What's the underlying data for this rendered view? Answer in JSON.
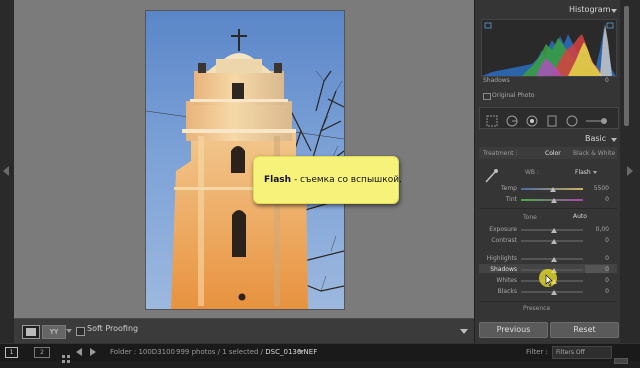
{
  "histogram": {
    "title": "Histogram",
    "left_readout": "Shadows",
    "right_readout": "0",
    "original_photo_label": "Original Photo"
  },
  "basic": {
    "title": "Basic",
    "treatment_label": "Treatment :",
    "treatment_options": [
      "Color",
      "Black & White"
    ],
    "treatment_selected": "Color",
    "wb_label": "WB :",
    "wb_value": "Flash",
    "temp_label": "Temp",
    "temp_value": "5500",
    "tint_label": "Tint",
    "tint_value": "0",
    "tone_label": "Tone",
    "auto_label": "Auto",
    "exposure_label": "Exposure",
    "exposure_value": "0,00",
    "contrast_label": "Contrast",
    "contrast_value": "0",
    "highlights_label": "Highlights",
    "highlights_value": "0",
    "shadows_label": "Shadows",
    "shadows_value": "0",
    "whites_label": "Whites",
    "whites_value": "0",
    "blacks_label": "Blacks",
    "blacks_value": "0",
    "presence_label": "Presence"
  },
  "buttons": {
    "previous": "Previous",
    "reset": "Reset"
  },
  "toolbar": {
    "view_mode_label": "YY",
    "soft_proofing_label": "Soft Proofing"
  },
  "status": {
    "screen1": "1",
    "screen2": "2",
    "folder": "Folder : 100D3100",
    "photos": "999 photos / 1 selected / ",
    "filename": "DSC_0136.NEF",
    "filename_suffix": "",
    "filter_label": "Filter :",
    "filter_value": "Filters Off"
  },
  "tooltip": {
    "bold": "Flash",
    "text": " - съемка со вспышкой."
  },
  "colors": {
    "accent_tooltip": "#f7f27a",
    "panel_bg": "#353535",
    "canvas_bg": "#7b7b7b",
    "cursor_highlight": "#f0e628"
  }
}
